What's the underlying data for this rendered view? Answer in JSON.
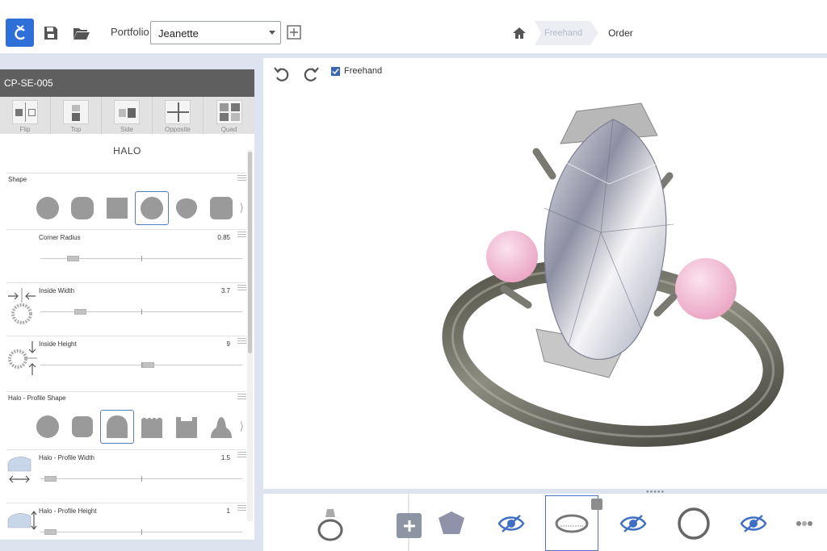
{
  "toolbar": {
    "portfolio_label": "Portfolio",
    "portfolio_value": "Jeanette"
  },
  "breadcrumb": {
    "active": "Freehand",
    "next": "Order"
  },
  "panel": {
    "model_id": "CP-SE-005",
    "views": [
      {
        "label": "Flip"
      },
      {
        "label": "Top"
      },
      {
        "label": "Side"
      },
      {
        "label": "Opposite"
      },
      {
        "label": "Quad"
      }
    ],
    "section": "HALO",
    "shape_group": {
      "label": "Shape",
      "selected_index": 3
    },
    "corner_radius": {
      "label": "Corner Radius",
      "value": "0.85",
      "level": 0.14
    },
    "inside_width": {
      "label": "Inside Width",
      "value": "3.7",
      "level": 0.18
    },
    "inside_height": {
      "label": "Inside Height",
      "value": "9",
      "level": 0.54
    },
    "profile_shape": {
      "label": "Halo - Profile Shape",
      "selected_index": 2
    },
    "profile_width": {
      "label": "Halo - Profile Width",
      "value": "1.5",
      "level": 0.02
    },
    "profile_height": {
      "label": "Halo - Profile Height",
      "value": "1",
      "level": 0.02
    }
  },
  "viewport": {
    "freehand_label": "Freehand",
    "freehand_checked": true
  },
  "colors": {
    "accent": "#2f6fd8",
    "metal": "#6b6b5f",
    "pink_stone": "#f2b6cf"
  }
}
